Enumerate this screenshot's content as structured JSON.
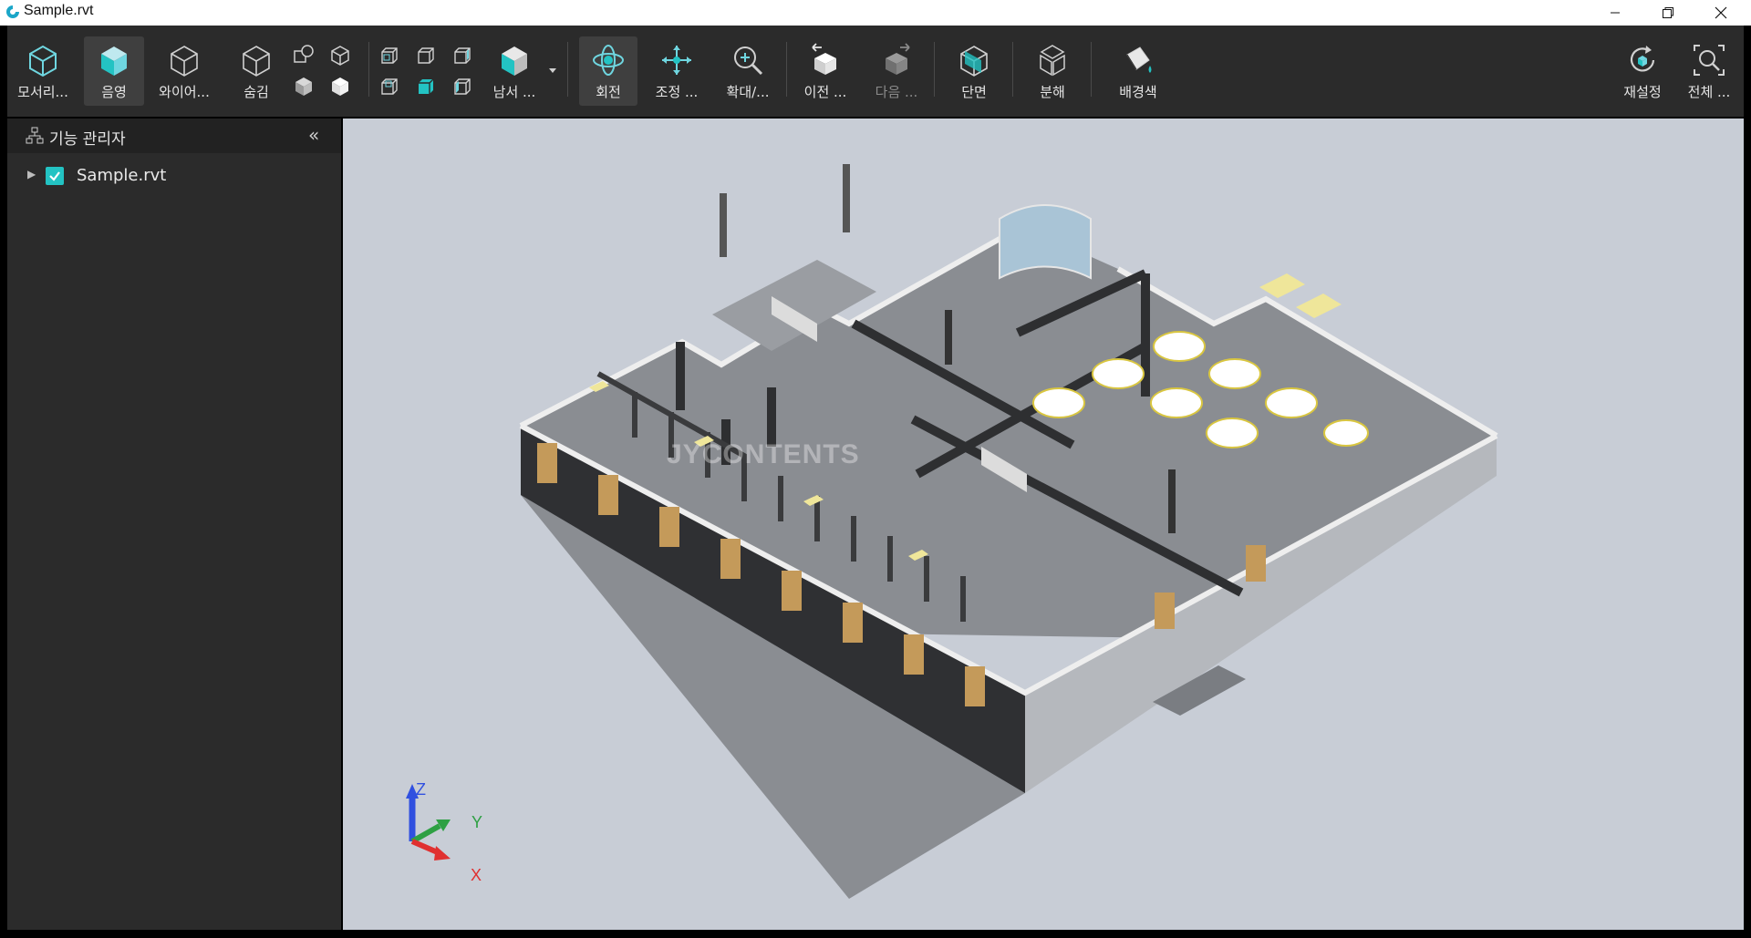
{
  "window": {
    "title": "Sample.rvt"
  },
  "toolbar": {
    "modeling": "모서리...",
    "shading": "음영",
    "wireframe": "와이어...",
    "hide": "숨김",
    "direction": "남서 ...",
    "orbit": "회전",
    "pan": "조정 ...",
    "zoom": "확대/...",
    "previous": "이전 ...",
    "next": "다음 ...",
    "section": "단면",
    "explode": "분해",
    "background": "배경색",
    "reset": "재설정",
    "fit_all": "전체 ..."
  },
  "sidebar": {
    "title": "기능 관리자",
    "collapse_glyph": "«",
    "tree": [
      {
        "label": "Sample.rvt",
        "checked": true,
        "expanded": false
      }
    ]
  },
  "viewport": {
    "watermark": "JYCONTENTS"
  },
  "axes": {
    "x": "X",
    "y": "Y",
    "z": "Z",
    "x_color": "#e03030",
    "y_color": "#2ea043",
    "z_color": "#3050e0"
  },
  "colors": {
    "accent": "#23c3c3",
    "toolbar_bg": "#2b2b2b",
    "viewport_bg": "#c8cdd6"
  }
}
